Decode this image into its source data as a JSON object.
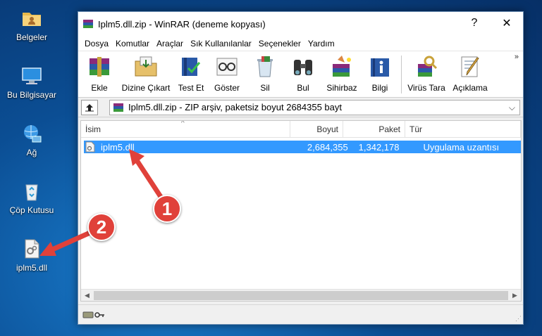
{
  "desktop": {
    "icons": [
      {
        "label": "Belgeler"
      },
      {
        "label": "Bu Bilgisayar"
      },
      {
        "label": "Ağ"
      },
      {
        "label": "Çöp Kutusu"
      },
      {
        "label": "iplm5.dll"
      }
    ]
  },
  "window": {
    "title": "Iplm5.dll.zip - WinRAR (deneme kopyası)",
    "help_label": "?",
    "close_label": "✕"
  },
  "menu": [
    "Dosya",
    "Komutlar",
    "Araçlar",
    "Sık Kullanılanlar",
    "Seçenekler",
    "Yardım"
  ],
  "toolbar": {
    "buttons": [
      "Ekle",
      "Dizine Çıkart",
      "Test Et",
      "Göster",
      "Sil",
      "Bul",
      "Sihirbaz",
      "Bilgi",
      "Virüs Tara",
      "Açıklama"
    ],
    "more": "»"
  },
  "address": {
    "text": "Iplm5.dll.zip - ZIP arşiv, paketsiz boyut 2684355 bayt"
  },
  "columns": {
    "name": "İsim",
    "size": "Boyut",
    "packed": "Paket",
    "type": "Tür"
  },
  "files": [
    {
      "name": "iplm5.dll",
      "size": "2,684,355",
      "packed": "1,342,178",
      "type": "Uygulama uzantısı"
    }
  ],
  "annotations": {
    "badge1": "1",
    "badge2": "2"
  },
  "colors": {
    "selection": "#3399ff",
    "badge": "#e0413a"
  }
}
